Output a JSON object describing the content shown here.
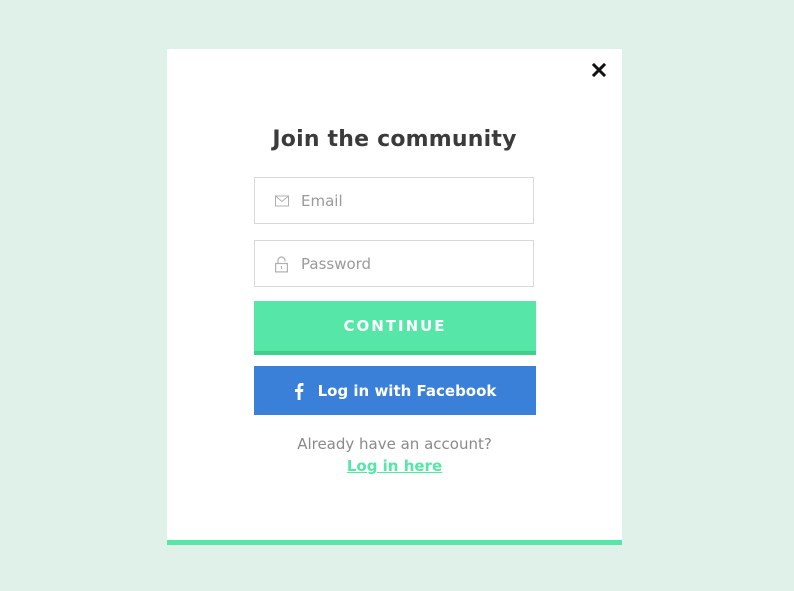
{
  "modal": {
    "title": "Join the community",
    "close_icon": "close-icon",
    "accent_color": "#55e6a8",
    "background_color": "#dff1e8"
  },
  "form": {
    "email": {
      "placeholder": "Email",
      "value": "",
      "icon": "envelope-icon"
    },
    "password": {
      "placeholder": "Password",
      "value": "",
      "icon": "lock-icon"
    },
    "continue_label": "CONTINUE",
    "continue_color": "#55e6a8",
    "facebook_label": "Log in with Facebook",
    "facebook_icon": "facebook-icon",
    "facebook_color": "#3a80d8"
  },
  "footer": {
    "prompt": "Already have an account?",
    "login_link": "Log in here"
  }
}
